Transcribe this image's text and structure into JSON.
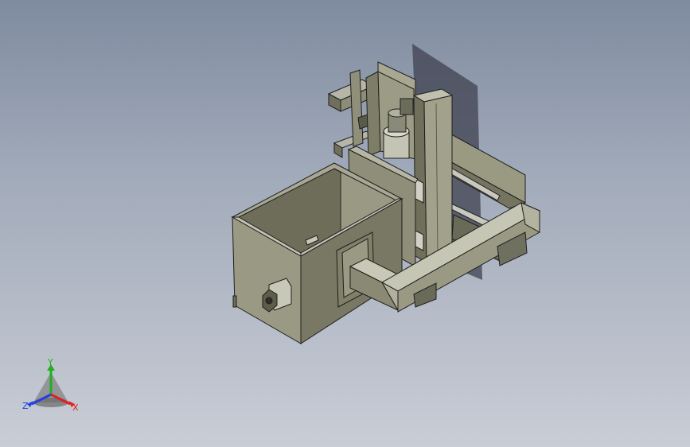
{
  "viewport": {
    "background_top": "#7f8ba0",
    "background_bottom": "#c9cdd6"
  },
  "model": {
    "body_color": "#8a8a72",
    "shadow_color": "#3f4250",
    "edge_color": "#1e1e1e"
  },
  "triad": {
    "x_label": "X",
    "y_label": "Y",
    "z_label": "Z",
    "x_color": "#e02020",
    "y_color": "#20b020",
    "z_color": "#2040e0"
  }
}
